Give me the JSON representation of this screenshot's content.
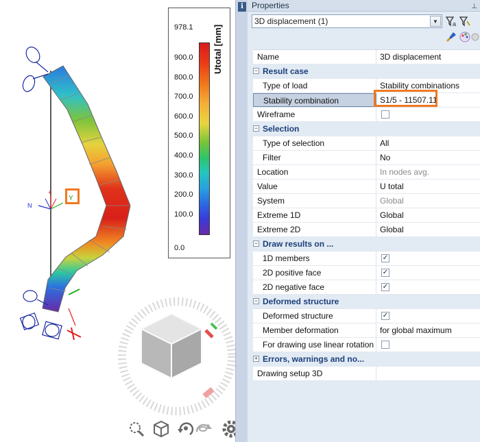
{
  "legend": {
    "title": "Utotal [mm]",
    "max_label": "978.1",
    "ticks": [
      "900.0",
      "800.0",
      "700.0",
      "600.0",
      "500.0",
      "400.0",
      "300.0",
      "200.0",
      "100.0",
      "0.0"
    ]
  },
  "viewport": {
    "axes": {
      "x": "X",
      "y": "Y",
      "z": "Z"
    },
    "toolbar_icons": [
      "zoom-icon",
      "cube-view-icon",
      "rotate-icon",
      "orbit-icon",
      "gear-icon"
    ]
  },
  "panel": {
    "title": "Properties",
    "info_icon": "i",
    "combo_value": "3D displacement (1)",
    "rows": [
      {
        "type": "prop",
        "key": "Name",
        "value": "3D displacement"
      },
      {
        "type": "section",
        "key": "Result case",
        "expander": "−"
      },
      {
        "type": "sub",
        "key": "Type of load",
        "value": "Stability combinations"
      },
      {
        "type": "sub",
        "key": "Stability combination",
        "value": "S1/5 - 11507.11",
        "selected": true
      },
      {
        "type": "check",
        "key": "Wireframe",
        "checked": false
      },
      {
        "type": "section",
        "key": "Selection",
        "expander": "−"
      },
      {
        "type": "sub",
        "key": "Type of selection",
        "value": "All"
      },
      {
        "type": "sub",
        "key": "Filter",
        "value": "No"
      },
      {
        "type": "prop",
        "key": "Location",
        "value": "In nodes avg.",
        "gray": true
      },
      {
        "type": "prop",
        "key": "Value",
        "value": "U total"
      },
      {
        "type": "prop",
        "key": "System",
        "value": "Global",
        "gray": true
      },
      {
        "type": "prop",
        "key": "Extreme 1D",
        "value": "Global"
      },
      {
        "type": "prop",
        "key": "Extreme 2D",
        "value": "Global"
      },
      {
        "type": "section",
        "key": "Draw results on ...",
        "expander": "−"
      },
      {
        "type": "check",
        "key": "1D members",
        "checked": true,
        "sub": true
      },
      {
        "type": "check",
        "key": "2D positive face",
        "checked": true,
        "sub": true
      },
      {
        "type": "check",
        "key": "2D negative face",
        "checked": true,
        "sub": true
      },
      {
        "type": "section",
        "key": "Deformed structure",
        "expander": "−"
      },
      {
        "type": "check",
        "key": "Deformed structure",
        "checked": true,
        "sub": true
      },
      {
        "type": "sub",
        "key": "Member deformation",
        "value": "for global maximum"
      },
      {
        "type": "check",
        "key": "For drawing use linear rotation",
        "checked": false,
        "sub": true
      },
      {
        "type": "section",
        "key": "Errors, warnings and no...",
        "expander": "+"
      },
      {
        "type": "prop",
        "key": "Drawing setup 3D",
        "value": ""
      }
    ]
  }
}
